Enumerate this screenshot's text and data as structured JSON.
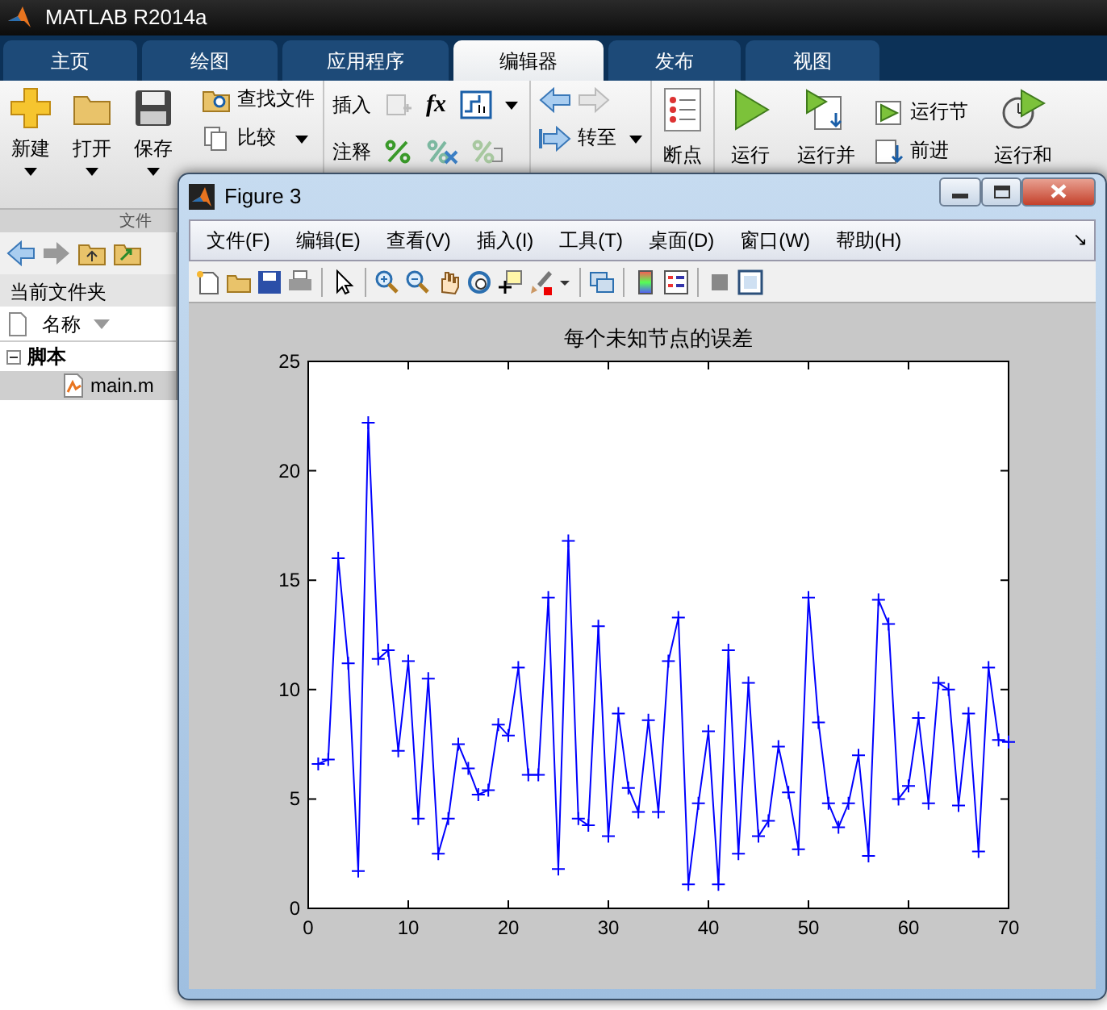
{
  "window": {
    "title": "MATLAB R2014a"
  },
  "tabs": [
    {
      "label": "主页",
      "selected": false
    },
    {
      "label": "绘图",
      "selected": false
    },
    {
      "label": "应用程序",
      "selected": false
    },
    {
      "label": "编辑器",
      "selected": true
    },
    {
      "label": "发布",
      "selected": false
    },
    {
      "label": "视图",
      "selected": false
    }
  ],
  "ribbon": {
    "big_buttons": [
      {
        "label": "新建",
        "dropdown": true
      },
      {
        "label": "打开",
        "dropdown": true
      },
      {
        "label": "保存",
        "dropdown": true
      }
    ],
    "file_buttons": [
      {
        "label": "查找文件",
        "dropdown": false
      },
      {
        "label": "比较",
        "dropdown": true
      }
    ],
    "edit_rows": [
      {
        "label": "插入"
      },
      {
        "label": "注释"
      }
    ],
    "fx_label": "fx",
    "nav_button": {
      "label": "转至",
      "dropdown": true
    },
    "breakpoint_button": {
      "label": "断点"
    },
    "run_buttons": [
      {
        "label": "运行"
      },
      {
        "label": "运行并"
      }
    ],
    "section_buttons": [
      {
        "label": "运行节"
      },
      {
        "label": "前进"
      }
    ],
    "timed_button": {
      "label": "运行和"
    },
    "group_label": "文件"
  },
  "current_folder": {
    "title": "当前文件夹",
    "column": "名称",
    "tree": [
      {
        "label": "脚本",
        "expanded": true,
        "children": [
          {
            "label": "main.m",
            "selected": true
          }
        ]
      }
    ]
  },
  "figure": {
    "title": "Figure 3",
    "menu": [
      "文件(F)",
      "编辑(E)",
      "查看(V)",
      "插入(I)",
      "工具(T)",
      "桌面(D)",
      "窗口(W)",
      "帮助(H)"
    ],
    "menu_arrow": "↘",
    "chart_data": {
      "type": "line",
      "title": "每个未知节点的误差",
      "x": [
        1,
        2,
        3,
        4,
        5,
        6,
        7,
        8,
        9,
        10,
        11,
        12,
        13,
        14,
        15,
        16,
        17,
        18,
        19,
        20,
        21,
        22,
        23,
        24,
        25,
        26,
        27,
        28,
        29,
        30,
        31,
        32,
        33,
        34,
        35,
        36,
        37,
        38,
        39,
        40,
        41,
        42,
        43,
        44,
        45,
        46,
        47,
        48,
        49,
        50,
        51,
        52,
        53,
        54,
        55,
        56,
        57,
        58,
        59,
        60,
        61,
        62,
        63,
        64,
        65,
        66,
        67,
        68,
        69,
        70
      ],
      "series": [
        {
          "color": "#0000ff",
          "marker": "+",
          "values": [
            6.6,
            6.8,
            16.0,
            11.2,
            1.7,
            22.2,
            11.4,
            11.8,
            7.2,
            11.3,
            4.1,
            10.5,
            2.5,
            4.1,
            7.5,
            6.4,
            5.2,
            5.4,
            8.4,
            7.9,
            11.0,
            6.1,
            6.1,
            14.2,
            1.8,
            16.8,
            4.1,
            3.8,
            12.9,
            3.3,
            8.9,
            5.5,
            4.4,
            8.6,
            4.4,
            11.3,
            13.3,
            1.1,
            4.8,
            8.1,
            1.1,
            11.8,
            2.5,
            10.3,
            3.3,
            4.0,
            7.4,
            5.3,
            2.7,
            14.2,
            8.5,
            4.8,
            3.7,
            4.8,
            7.0,
            2.4,
            14.1,
            13.0,
            5.0,
            5.6,
            8.7,
            4.8,
            10.3,
            10.0,
            4.7,
            8.9,
            2.6,
            11.0,
            7.7,
            7.6
          ]
        }
      ],
      "xlim": [
        0,
        70
      ],
      "ylim": [
        0,
        25
      ],
      "xticks": [
        0,
        10,
        20,
        30,
        40,
        50,
        60,
        70
      ],
      "yticks": [
        0,
        5,
        10,
        15,
        20,
        25
      ]
    }
  }
}
